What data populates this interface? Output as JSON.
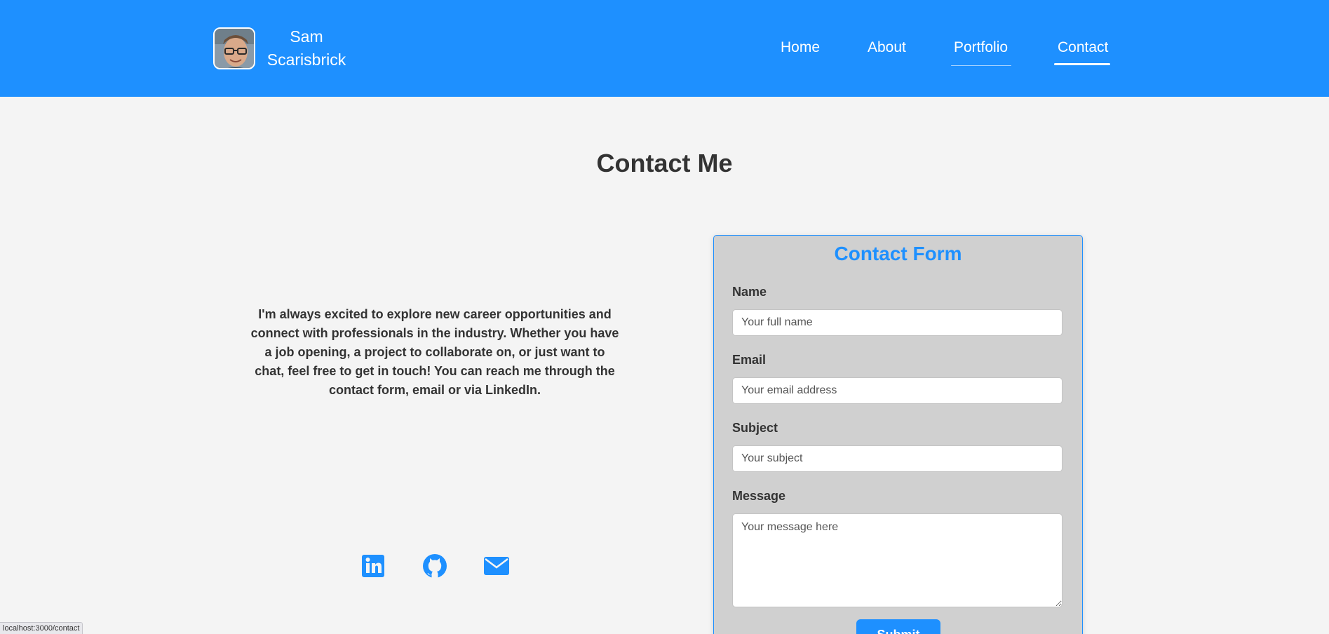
{
  "header": {
    "brand_name": "Sam Scarisbrick",
    "avatar_alt": "Sam Scarisbrick profile photo",
    "nav": [
      {
        "label": "Home",
        "active": false
      },
      {
        "label": "About",
        "active": false
      },
      {
        "label": "Portfolio",
        "active": false
      },
      {
        "label": "Contact",
        "active": true
      }
    ]
  },
  "main": {
    "title": "Contact Me",
    "intro": "I'm always excited to explore new career opportunities and connect with professionals in the industry. Whether you have a job opening, a project to collaborate on, or just want to chat, feel free to get in touch! You can reach me through the contact form, email or via LinkedIn.",
    "social": [
      {
        "icon": "linkedin-icon"
      },
      {
        "icon": "github-icon"
      },
      {
        "icon": "email-icon"
      }
    ]
  },
  "form": {
    "title": "Contact Form",
    "fields": {
      "name": {
        "label": "Name",
        "placeholder": "Your full name",
        "value": ""
      },
      "email": {
        "label": "Email",
        "placeholder": "Your email address",
        "value": ""
      },
      "subject": {
        "label": "Subject",
        "placeholder": "Your subject",
        "value": ""
      },
      "message": {
        "label": "Message",
        "placeholder": "Your message here",
        "value": ""
      }
    },
    "submit_label": "Submit"
  },
  "status_bar": {
    "url": "localhost:3000/contact"
  },
  "colors": {
    "accent": "#1e90ff",
    "background": "#f4f4f4",
    "form_background": "#d0d0d0",
    "text": "#333333"
  }
}
